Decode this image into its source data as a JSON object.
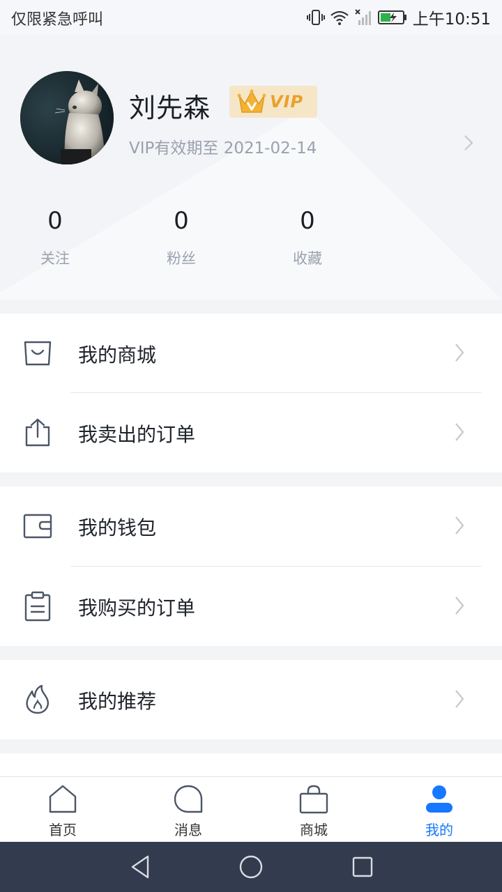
{
  "status_bar": {
    "carrier_text": "仅限紧急呼叫",
    "time": "上午10:51",
    "icons": [
      "vibrate-icon",
      "wifi-icon",
      "no-signal-icon",
      "battery-charging-icon"
    ]
  },
  "profile": {
    "username": "刘先森",
    "vip_label": "VIP",
    "vip_expiry": "VIP有效期至 2021-02-14",
    "stats": [
      {
        "count": "0",
        "label": "关注"
      },
      {
        "count": "0",
        "label": "粉丝"
      },
      {
        "count": "0",
        "label": "收藏"
      }
    ]
  },
  "menu_sections": [
    [
      {
        "label": "我的商城",
        "icon": "bag-icon"
      },
      {
        "label": "我卖出的订单",
        "icon": "share-icon"
      }
    ],
    [
      {
        "label": "我的钱包",
        "icon": "wallet-icon"
      },
      {
        "label": "我购买的订单",
        "icon": "clipboard-icon"
      }
    ],
    [
      {
        "label": "我的推荐",
        "icon": "flame-icon"
      }
    ]
  ],
  "tab_bar": {
    "tabs": [
      {
        "label": "首页",
        "icon": "home-icon"
      },
      {
        "label": "消息",
        "icon": "message-icon"
      },
      {
        "label": "商城",
        "icon": "shopping-bag-icon"
      },
      {
        "label": "我的",
        "icon": "user-icon",
        "active": true
      }
    ]
  },
  "colors": {
    "accent": "#1677ff",
    "vip_gold": "#e8a12b",
    "vip_badge_bg": "#f6e6c8",
    "nav_bar_bg": "#333c4f"
  }
}
